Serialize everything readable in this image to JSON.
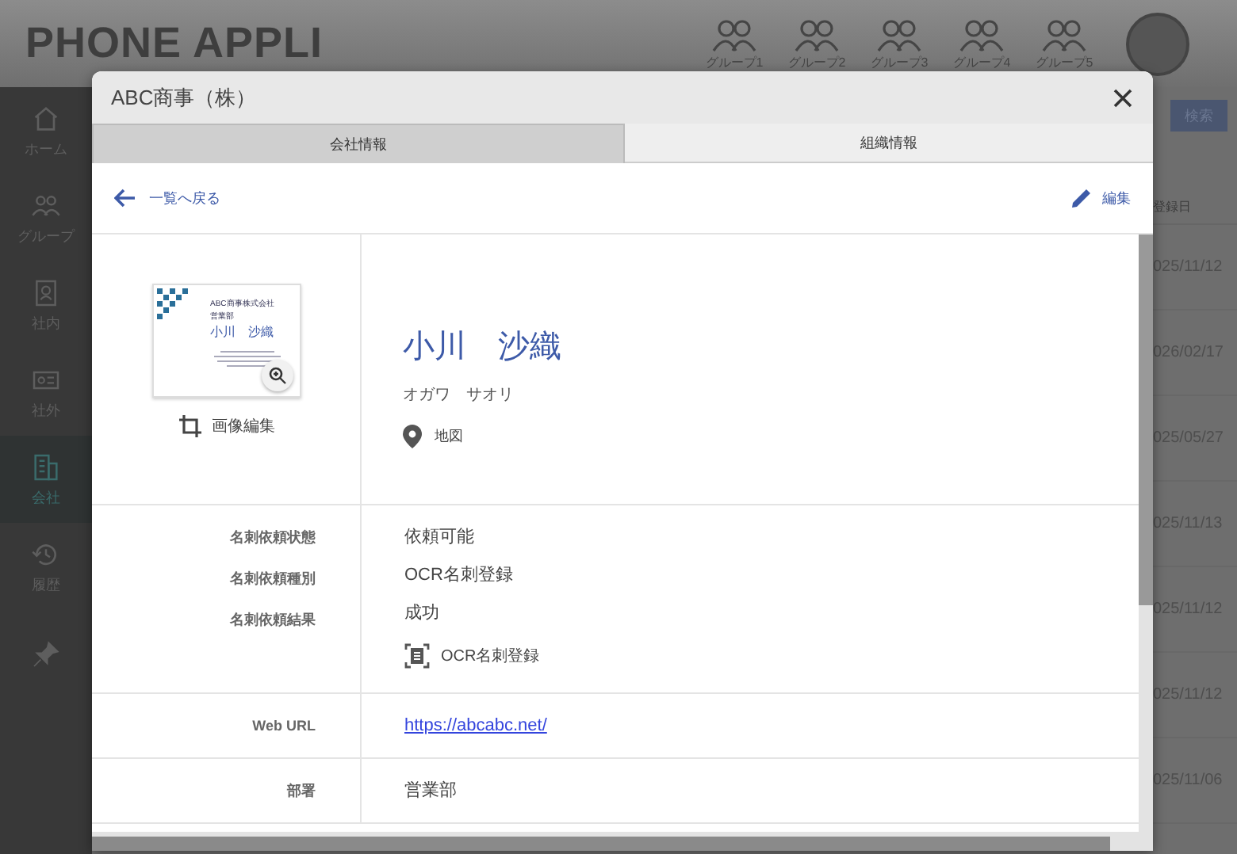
{
  "app": {
    "logo": "PHONE APPLI",
    "groups": [
      "グループ1",
      "グループ2",
      "グループ3",
      "グループ4",
      "グループ5"
    ],
    "sidebar": [
      {
        "kind": "home",
        "label": "ホーム",
        "selected": false
      },
      {
        "kind": "group",
        "label": "グループ",
        "selected": false
      },
      {
        "kind": "book",
        "label": "社内",
        "selected": false
      },
      {
        "kind": "card",
        "label": "社外",
        "selected": false
      },
      {
        "kind": "building",
        "label": "会社",
        "selected": true
      },
      {
        "kind": "history",
        "label": "履歴",
        "selected": false
      },
      {
        "kind": "pin",
        "selected": false
      }
    ],
    "search_button": "検索",
    "column_header": "登録日",
    "dates": [
      "025/11/12",
      "026/02/17",
      "025/05/27",
      "025/11/13",
      "025/11/12",
      "025/11/12",
      "025/11/06"
    ]
  },
  "dialog": {
    "title": "ABC商事（株）",
    "tabs": [
      {
        "label": "会社情報",
        "selected": true
      },
      {
        "label": "組織情報",
        "selected": false
      }
    ],
    "back_link": "一覧へ戻る",
    "edit_button": "編集",
    "card_image": {
      "lines": [
        "ABC商事株式会社",
        "営業部",
        "小川　沙織"
      ]
    },
    "image_edit": "画像編集",
    "name": "小川　沙織",
    "kana": "オガワ　サオリ",
    "map_link": "地図",
    "sections": [
      {
        "rows": [
          {
            "kind": "text",
            "label": "名刺依頼状態",
            "value": "依頼可能"
          },
          {
            "kind": "text",
            "label": "名刺依頼種別",
            "value": "OCR名刺登録"
          },
          {
            "kind": "text",
            "label": "名刺依頼結果",
            "value": "成功"
          },
          {
            "kind": "ocr",
            "value": "OCR名刺登録"
          }
        ]
      },
      {
        "rows": [
          {
            "kind": "link",
            "label": "Web URL",
            "value": "https://abcabc.net/"
          }
        ]
      },
      {
        "rows": [
          {
            "kind": "text",
            "label": "部署",
            "value": "営業部"
          }
        ]
      }
    ]
  }
}
